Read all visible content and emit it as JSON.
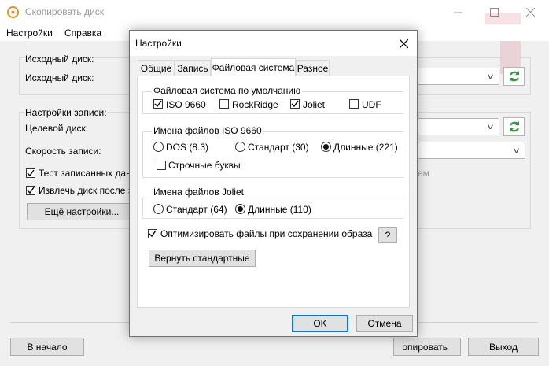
{
  "main": {
    "title": "Скопировать диск",
    "menu": [
      "Настройки",
      "Справка"
    ],
    "source_group": {
      "title": "Исходный диск:",
      "label": "Исходный диск:"
    },
    "write_group": {
      "title": "Настройки записи:",
      "target_label": "Целевой диск:",
      "speed_label": "Скорость записи:",
      "test_label": "Тест записанных данны",
      "test_checked": true,
      "eject_label": "Извлечь диск после запи",
      "eject_checked": true,
      "more_button": "Ещё настройки...",
      "partial_text": "ем"
    },
    "bottom": {
      "home_button": "В начало",
      "copy_button": "опировать",
      "exit_button": "Выход"
    }
  },
  "dialog": {
    "title": "Настройки",
    "tabs": [
      "Общие",
      "Запись",
      "Файловая система",
      "Разное"
    ],
    "active_tab": "Файловая система",
    "fs_default": {
      "title": "Файловая система по умолчанию",
      "options": [
        {
          "label": "ISO 9660",
          "checked": true
        },
        {
          "label": "RockRidge",
          "checked": false
        },
        {
          "label": "Joliet",
          "checked": true
        },
        {
          "label": "UDF",
          "checked": false
        }
      ]
    },
    "iso_names": {
      "title": "Имена файлов ISO 9660",
      "options": [
        {
          "label": "DOS (8.3)",
          "selected": false
        },
        {
          "label": "Стандарт (30)",
          "selected": false
        },
        {
          "label": "Длинные (221)",
          "selected": true
        }
      ],
      "lowercase_label": "Строчные буквы",
      "lowercase_checked": false
    },
    "joliet_names": {
      "title": "Имена файлов Joliet",
      "options": [
        {
          "label": "Стандарт (64)",
          "selected": false
        },
        {
          "label": "Длинные (110)",
          "selected": true
        }
      ]
    },
    "optimize_label": "Оптимизировать файлы при сохранении образа",
    "optimize_checked": true,
    "help_button": "?",
    "reset_button": "Вернуть стандартные",
    "ok_button": "OK",
    "cancel_button": "Отмена"
  },
  "colors": {
    "accent": "#0078d7",
    "refresh_green": "#2e9a3c",
    "watermark": "#c80a1e"
  }
}
